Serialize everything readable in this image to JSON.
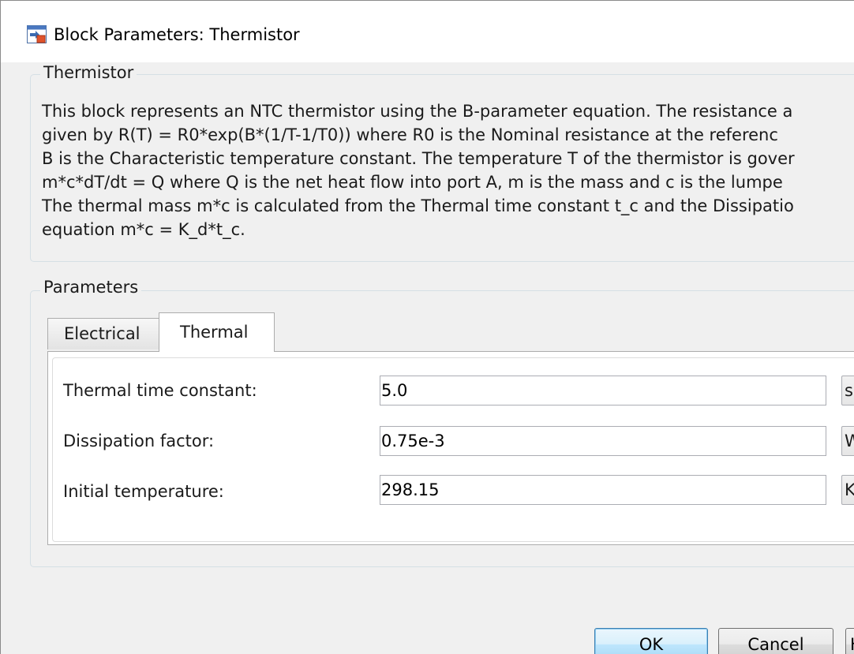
{
  "window": {
    "title": "Block Parameters: Thermistor"
  },
  "description": {
    "heading": "Thermistor",
    "lines": [
      "This block represents an NTC thermistor using the B-parameter equation. The resistance a",
      "given by R(T) = R0*exp(B*(1/T-1/T0)) where R0 is the Nominal resistance at the referenc",
      "B is the Characteristic temperature constant. The temperature T of the thermistor is gover",
      "m*c*dT/dt = Q where Q is the net heat flow into port A, m is the mass and c is the lumpe",
      "The thermal mass m*c is calculated from the Thermal time constant t_c and the Dissipatio",
      "equation m*c = K_d*t_c."
    ]
  },
  "parameters": {
    "heading": "Parameters",
    "tabs": [
      {
        "label": "Electrical",
        "selected": false
      },
      {
        "label": "Thermal",
        "selected": true
      }
    ],
    "fields": [
      {
        "label": "Thermal time constant:",
        "value": "5.0",
        "unit": "s"
      },
      {
        "label": "Dissipation factor:",
        "value": "0.75e-3",
        "unit": "W"
      },
      {
        "label": "Initial temperature:",
        "value": "298.15",
        "unit": "K"
      }
    ]
  },
  "buttons": {
    "ok": "OK",
    "cancel": "Cancel",
    "help": "Help"
  },
  "icons": {
    "title_icon": "block-parameters-icon"
  }
}
